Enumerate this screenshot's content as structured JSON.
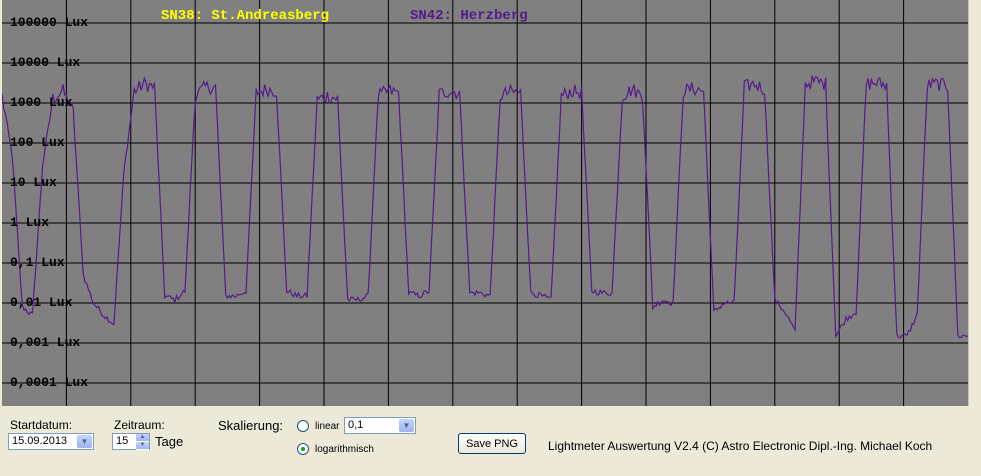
{
  "chart_data": {
    "type": "line",
    "y_scale": "log",
    "ylim": [
      0.0001,
      100000
    ],
    "y_tick_labels": [
      "100000 Lux",
      "10000 Lux",
      "1000 Lux",
      "100 Lux",
      "10 Lux",
      "1 Lux",
      "0,1 Lux",
      "0,01 Lux",
      "0,001 Lux",
      "0,0001 Lux"
    ],
    "x_days": 15,
    "grid": true,
    "background": "#808080",
    "series": [
      {
        "name": "SN38: St.Andreasberg",
        "color": "#ffff00",
        "y": []
      },
      {
        "name": "SN42: Herzberg",
        "color": "#551a8b",
        "y": [
          1500,
          50,
          0.008,
          0.005,
          30,
          1300,
          2000,
          600,
          0.05,
          0.01,
          0.005,
          0.003,
          20,
          2000,
          3000,
          2500,
          0.015,
          0.012,
          0.02,
          1500,
          2500,
          2500,
          0.015,
          0.015,
          0.02,
          1800,
          2200,
          2000,
          0.02,
          0.015,
          0.015,
          1200,
          1500,
          1300,
          0.012,
          0.012,
          0.015,
          1500,
          2000,
          1800,
          0.018,
          0.015,
          0.02,
          1700,
          2000,
          1800,
          0.018,
          0.018,
          0.015,
          1500,
          1900,
          1800,
          0.018,
          0.015,
          0.012,
          1500,
          2000,
          1800,
          0.02,
          0.018,
          0.018,
          1500,
          2200,
          1500,
          0.008,
          0.012,
          0.01,
          2000,
          2300,
          2000,
          0.006,
          0.01,
          0.01,
          2500,
          3000,
          2200,
          0.012,
          0.006,
          0.002,
          3000,
          3500,
          3000,
          0.0015,
          0.004,
          0.006,
          3000,
          3200,
          2800,
          0.0015,
          0.0015,
          0.005,
          2800,
          3000,
          2600,
          0.0015,
          0.0015
        ]
      }
    ]
  },
  "legend": {
    "sn38": "SN38: St.Andreasberg",
    "sn42": "SN42: Herzberg"
  },
  "controls": {
    "startdatum_label": "Startdatum:",
    "startdatum_value": "15.09.2013",
    "zeitraum_label": "Zeitraum:",
    "zeitraum_value": "15",
    "tage_label": "Tage",
    "skalierung_label": "Skalierung:",
    "linear_label": "linear",
    "linear_value": "0,1",
    "log_label": "logarithmisch",
    "save_button": "Save PNG",
    "credit": "Lightmeter Auswertung V2.4  (C) Astro Electronic Dipl.-Ing. Michael Koch"
  }
}
